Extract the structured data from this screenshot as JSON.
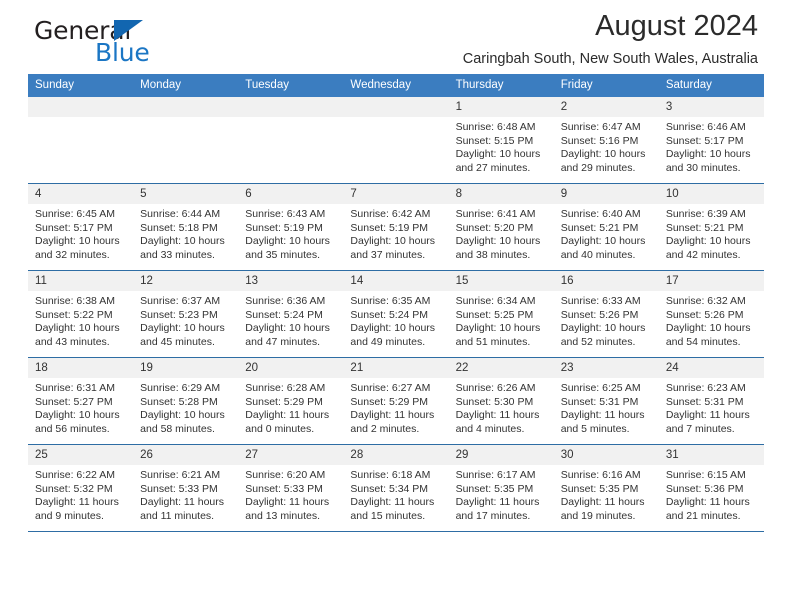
{
  "brand": {
    "name_top": "General",
    "name_bottom": "Blue",
    "triangle_color": "#1266b0",
    "blue_color": "#1b76c4"
  },
  "header": {
    "title": "August 2024",
    "subtitle": "Caringbah South, New South Wales, Australia"
  },
  "theme": {
    "header_band": "#3b7dc0",
    "row_rule": "#2e6da4",
    "daynum_band": "#f1f1f1",
    "text": "#333333"
  },
  "calendar": {
    "weekday_headers": [
      "Sunday",
      "Monday",
      "Tuesday",
      "Wednesday",
      "Thursday",
      "Friday",
      "Saturday"
    ],
    "labels": {
      "sunrise": "Sunrise:",
      "sunset": "Sunset:",
      "daylight": "Daylight:"
    },
    "weeks": [
      [
        {
          "day": "",
          "empty": true
        },
        {
          "day": "",
          "empty": true
        },
        {
          "day": "",
          "empty": true
        },
        {
          "day": "",
          "empty": true
        },
        {
          "day": "1",
          "sunrise": "Sunrise: 6:48 AM",
          "sunset": "Sunset: 5:15 PM",
          "daylight_1": "Daylight: 10 hours",
          "daylight_2": "and 27 minutes."
        },
        {
          "day": "2",
          "sunrise": "Sunrise: 6:47 AM",
          "sunset": "Sunset: 5:16 PM",
          "daylight_1": "Daylight: 10 hours",
          "daylight_2": "and 29 minutes."
        },
        {
          "day": "3",
          "sunrise": "Sunrise: 6:46 AM",
          "sunset": "Sunset: 5:17 PM",
          "daylight_1": "Daylight: 10 hours",
          "daylight_2": "and 30 minutes."
        }
      ],
      [
        {
          "day": "4",
          "sunrise": "Sunrise: 6:45 AM",
          "sunset": "Sunset: 5:17 PM",
          "daylight_1": "Daylight: 10 hours",
          "daylight_2": "and 32 minutes."
        },
        {
          "day": "5",
          "sunrise": "Sunrise: 6:44 AM",
          "sunset": "Sunset: 5:18 PM",
          "daylight_1": "Daylight: 10 hours",
          "daylight_2": "and 33 minutes."
        },
        {
          "day": "6",
          "sunrise": "Sunrise: 6:43 AM",
          "sunset": "Sunset: 5:19 PM",
          "daylight_1": "Daylight: 10 hours",
          "daylight_2": "and 35 minutes."
        },
        {
          "day": "7",
          "sunrise": "Sunrise: 6:42 AM",
          "sunset": "Sunset: 5:19 PM",
          "daylight_1": "Daylight: 10 hours",
          "daylight_2": "and 37 minutes."
        },
        {
          "day": "8",
          "sunrise": "Sunrise: 6:41 AM",
          "sunset": "Sunset: 5:20 PM",
          "daylight_1": "Daylight: 10 hours",
          "daylight_2": "and 38 minutes."
        },
        {
          "day": "9",
          "sunrise": "Sunrise: 6:40 AM",
          "sunset": "Sunset: 5:21 PM",
          "daylight_1": "Daylight: 10 hours",
          "daylight_2": "and 40 minutes."
        },
        {
          "day": "10",
          "sunrise": "Sunrise: 6:39 AM",
          "sunset": "Sunset: 5:21 PM",
          "daylight_1": "Daylight: 10 hours",
          "daylight_2": "and 42 minutes."
        }
      ],
      [
        {
          "day": "11",
          "sunrise": "Sunrise: 6:38 AM",
          "sunset": "Sunset: 5:22 PM",
          "daylight_1": "Daylight: 10 hours",
          "daylight_2": "and 43 minutes."
        },
        {
          "day": "12",
          "sunrise": "Sunrise: 6:37 AM",
          "sunset": "Sunset: 5:23 PM",
          "daylight_1": "Daylight: 10 hours",
          "daylight_2": "and 45 minutes."
        },
        {
          "day": "13",
          "sunrise": "Sunrise: 6:36 AM",
          "sunset": "Sunset: 5:24 PM",
          "daylight_1": "Daylight: 10 hours",
          "daylight_2": "and 47 minutes."
        },
        {
          "day": "14",
          "sunrise": "Sunrise: 6:35 AM",
          "sunset": "Sunset: 5:24 PM",
          "daylight_1": "Daylight: 10 hours",
          "daylight_2": "and 49 minutes."
        },
        {
          "day": "15",
          "sunrise": "Sunrise: 6:34 AM",
          "sunset": "Sunset: 5:25 PM",
          "daylight_1": "Daylight: 10 hours",
          "daylight_2": "and 51 minutes."
        },
        {
          "day": "16",
          "sunrise": "Sunrise: 6:33 AM",
          "sunset": "Sunset: 5:26 PM",
          "daylight_1": "Daylight: 10 hours",
          "daylight_2": "and 52 minutes."
        },
        {
          "day": "17",
          "sunrise": "Sunrise: 6:32 AM",
          "sunset": "Sunset: 5:26 PM",
          "daylight_1": "Daylight: 10 hours",
          "daylight_2": "and 54 minutes."
        }
      ],
      [
        {
          "day": "18",
          "sunrise": "Sunrise: 6:31 AM",
          "sunset": "Sunset: 5:27 PM",
          "daylight_1": "Daylight: 10 hours",
          "daylight_2": "and 56 minutes."
        },
        {
          "day": "19",
          "sunrise": "Sunrise: 6:29 AM",
          "sunset": "Sunset: 5:28 PM",
          "daylight_1": "Daylight: 10 hours",
          "daylight_2": "and 58 minutes."
        },
        {
          "day": "20",
          "sunrise": "Sunrise: 6:28 AM",
          "sunset": "Sunset: 5:29 PM",
          "daylight_1": "Daylight: 11 hours",
          "daylight_2": "and 0 minutes."
        },
        {
          "day": "21",
          "sunrise": "Sunrise: 6:27 AM",
          "sunset": "Sunset: 5:29 PM",
          "daylight_1": "Daylight: 11 hours",
          "daylight_2": "and 2 minutes."
        },
        {
          "day": "22",
          "sunrise": "Sunrise: 6:26 AM",
          "sunset": "Sunset: 5:30 PM",
          "daylight_1": "Daylight: 11 hours",
          "daylight_2": "and 4 minutes."
        },
        {
          "day": "23",
          "sunrise": "Sunrise: 6:25 AM",
          "sunset": "Sunset: 5:31 PM",
          "daylight_1": "Daylight: 11 hours",
          "daylight_2": "and 5 minutes."
        },
        {
          "day": "24",
          "sunrise": "Sunrise: 6:23 AM",
          "sunset": "Sunset: 5:31 PM",
          "daylight_1": "Daylight: 11 hours",
          "daylight_2": "and 7 minutes."
        }
      ],
      [
        {
          "day": "25",
          "sunrise": "Sunrise: 6:22 AM",
          "sunset": "Sunset: 5:32 PM",
          "daylight_1": "Daylight: 11 hours",
          "daylight_2": "and 9 minutes."
        },
        {
          "day": "26",
          "sunrise": "Sunrise: 6:21 AM",
          "sunset": "Sunset: 5:33 PM",
          "daylight_1": "Daylight: 11 hours",
          "daylight_2": "and 11 minutes."
        },
        {
          "day": "27",
          "sunrise": "Sunrise: 6:20 AM",
          "sunset": "Sunset: 5:33 PM",
          "daylight_1": "Daylight: 11 hours",
          "daylight_2": "and 13 minutes."
        },
        {
          "day": "28",
          "sunrise": "Sunrise: 6:18 AM",
          "sunset": "Sunset: 5:34 PM",
          "daylight_1": "Daylight: 11 hours",
          "daylight_2": "and 15 minutes."
        },
        {
          "day": "29",
          "sunrise": "Sunrise: 6:17 AM",
          "sunset": "Sunset: 5:35 PM",
          "daylight_1": "Daylight: 11 hours",
          "daylight_2": "and 17 minutes."
        },
        {
          "day": "30",
          "sunrise": "Sunrise: 6:16 AM",
          "sunset": "Sunset: 5:35 PM",
          "daylight_1": "Daylight: 11 hours",
          "daylight_2": "and 19 minutes."
        },
        {
          "day": "31",
          "sunrise": "Sunrise: 6:15 AM",
          "sunset": "Sunset: 5:36 PM",
          "daylight_1": "Daylight: 11 hours",
          "daylight_2": "and 21 minutes."
        }
      ]
    ]
  }
}
